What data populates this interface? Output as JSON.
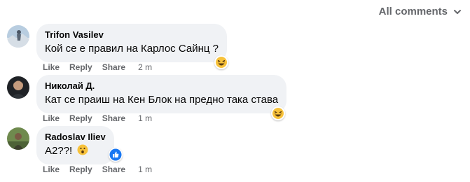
{
  "header": {
    "filter_label": "All comments"
  },
  "comments": [
    {
      "author": "Trifon Vasilev",
      "text": "Кой се е правил на Карлос Сайнц ?",
      "reaction": "laughing-emoji",
      "actions": {
        "like": "Like",
        "reply": "Reply",
        "share": "Share",
        "time": "2 m"
      }
    },
    {
      "author": "Николай Д.",
      "text": "Кат се праиш на Кен Блок на предно така става",
      "reaction": "laughing-emoji",
      "actions": {
        "like": "Like",
        "reply": "Reply",
        "share": "Share",
        "time": "1 m"
      }
    },
    {
      "author": "Radoslav Iliev",
      "text": "A2??!",
      "emoji": "surprised-emoji",
      "reaction": "like-icon",
      "actions": {
        "like": "Like",
        "reply": "Reply",
        "share": "Share",
        "time": "1 m"
      }
    }
  ],
  "colors": {
    "bubble": "#f0f2f5",
    "muted": "#65676b",
    "like_blue": "#1877f2",
    "emoji_yellow": "#f7c23b"
  }
}
